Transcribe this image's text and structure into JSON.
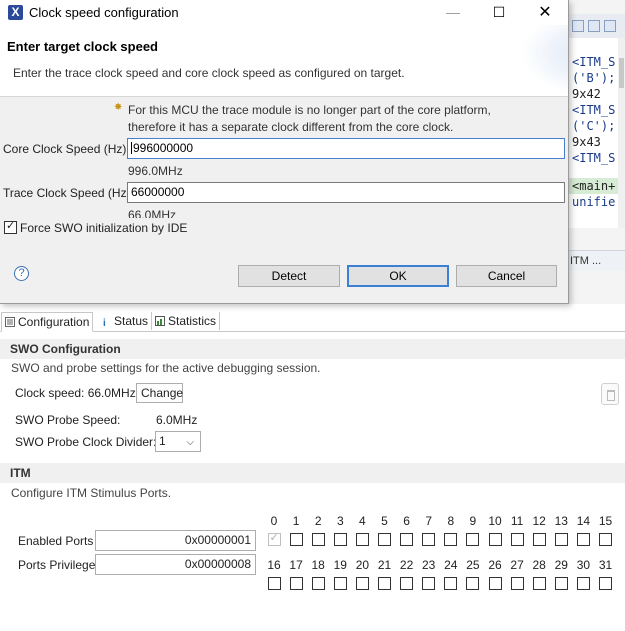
{
  "dialog": {
    "title": "Clock speed configuration",
    "app_icon": "X",
    "header_title": "Enter target clock speed",
    "header_desc": "Enter the trace clock speed and core clock speed as configured on target.",
    "info_icon": "info-bullet-icon",
    "info_text_line1": "For this MCU the trace module is no longer part of the core platform,",
    "info_text_line2": "therefore it has a separate clock different from the core clock.",
    "core_label": "Core Clock Speed (Hz):",
    "core_value": "996000000",
    "core_hint": "996.0MHz",
    "trace_label": "Trace Clock Speed (Hz):",
    "trace_value": "66000000",
    "trace_hint": "66.0MHz",
    "force_label": "Force SWO initialization by IDE",
    "force_checked": true,
    "help": "?",
    "detect": "Detect",
    "ok": "OK",
    "cancel": "Cancel",
    "minimize_glyph": "—",
    "maximize_glyph": "☐",
    "close_glyph": "✕"
  },
  "code": {
    "lines": [
      "<ITM_S",
      "('B');",
      "9x42",
      "<ITM_S",
      "('C');",
      "9x43",
      "<ITM_S",
      "",
      "<main+",
      "unifie"
    ],
    "pane_tab": "ITM ..."
  },
  "tabs": {
    "configuration": "Configuration",
    "status": "Status",
    "statistics": "Statistics"
  },
  "swo": {
    "heading": "SWO Configuration",
    "desc": "SWO and probe settings for the active debugging session.",
    "clock_speed": "Clock speed: 66.0MHz",
    "change": "Change",
    "probe_speed_label": "SWO Probe Speed:",
    "probe_speed_value": "6.0MHz",
    "divider_label": "SWO Probe Clock Divider:",
    "divider_value": "1"
  },
  "itm": {
    "heading": "ITM",
    "desc": "Configure ITM Stimulus Ports.",
    "enabled_label": "Enabled Ports",
    "enabled_value": "0x00000001",
    "privilege_label": "Ports Privilege",
    "privilege_value": "0x00000008",
    "ports_row1": [
      "0",
      "1",
      "2",
      "3",
      "4",
      "5",
      "6",
      "7",
      "8",
      "9",
      "10",
      "11",
      "12",
      "13",
      "14",
      "15"
    ],
    "ports_row2": [
      "16",
      "17",
      "18",
      "19",
      "20",
      "21",
      "22",
      "23",
      "24",
      "25",
      "26",
      "27",
      "28",
      "29",
      "30",
      "31"
    ],
    "port0_enabled": true
  }
}
